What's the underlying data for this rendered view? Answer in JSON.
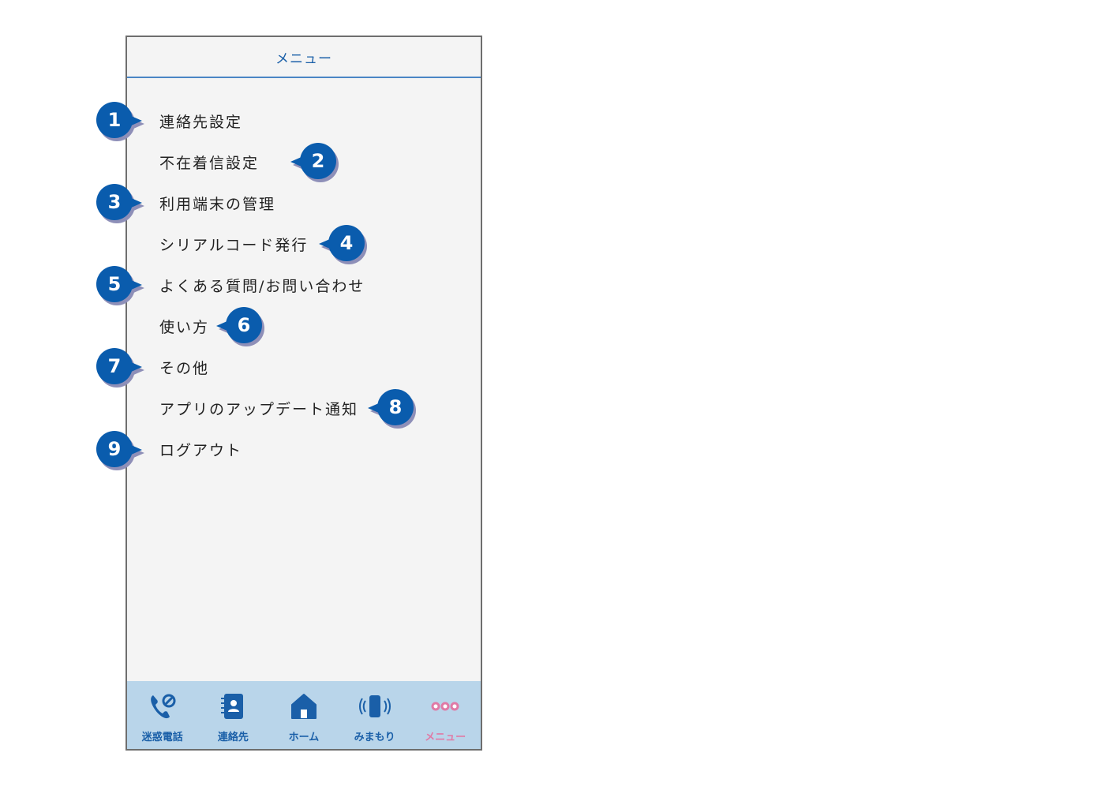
{
  "header": {
    "title": "メニュー"
  },
  "menu": {
    "items": [
      {
        "label": "連絡先設定",
        "badge": "1"
      },
      {
        "label": "不在着信設定",
        "badge": "2"
      },
      {
        "label": "利用端末の管理",
        "badge": "3"
      },
      {
        "label": "シリアルコード発行",
        "badge": "4"
      },
      {
        "label": "よくある質問/お問い合わせ",
        "badge": "5"
      },
      {
        "label": "使い方",
        "badge": "6"
      },
      {
        "label": "その他",
        "badge": "7"
      },
      {
        "label": "アプリのアップデート通知",
        "badge": "8"
      },
      {
        "label": "ログアウト",
        "badge": "9"
      }
    ]
  },
  "tabbar": {
    "tabs": [
      {
        "label": "迷惑電話",
        "icon": "blocked-call-icon"
      },
      {
        "label": "連絡先",
        "icon": "contacts-book-icon"
      },
      {
        "label": "ホーム",
        "icon": "home-icon"
      },
      {
        "label": "みまもり",
        "icon": "vibrating-phone-icon"
      },
      {
        "label": "メニュー",
        "icon": "more-dots-icon"
      }
    ]
  },
  "colors": {
    "accent": "#1a5fa8",
    "badge": "#0a5cad",
    "badge_shadow": "#8e8fb8",
    "tabbar_bg": "#b9d5ea",
    "active_tab": "#e07aa6",
    "header_rule": "#4a86c5"
  }
}
